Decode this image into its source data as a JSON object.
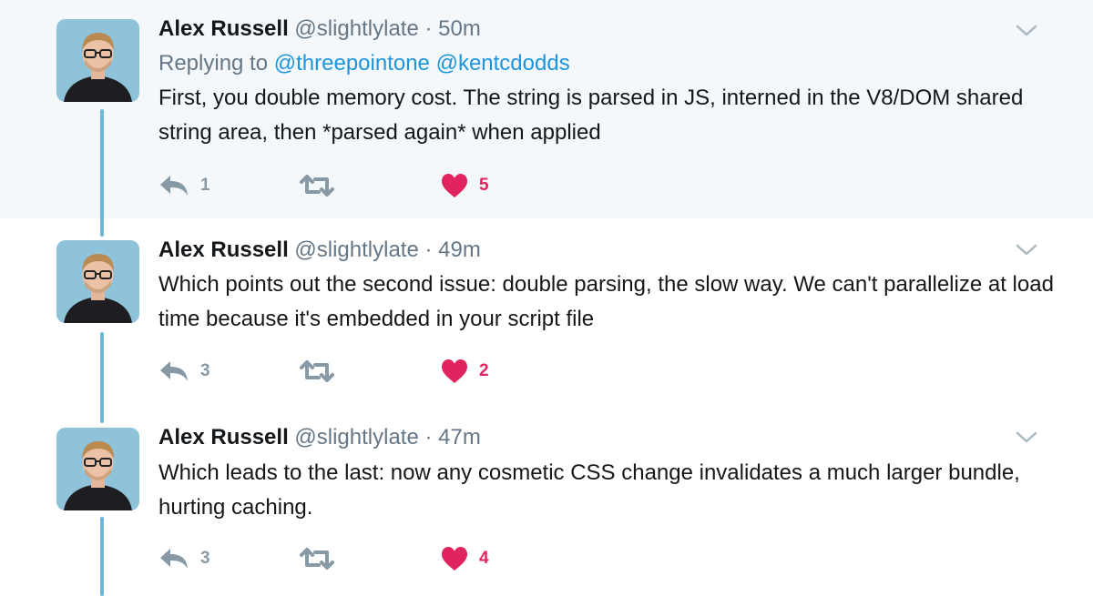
{
  "tweets": [
    {
      "name": "Alex Russell",
      "handle": "@slightlylate",
      "separator": "·",
      "time": "50m",
      "replying_prefix": "Replying to ",
      "mentions": [
        "@threepointone",
        "@kentcdodds"
      ],
      "text": "First, you double memory cost. The string is parsed in JS, interned in the V8/DOM shared string area, then *parsed again* when applied",
      "reply_count": "1",
      "retweet_count": "",
      "like_count": "5",
      "liked": true,
      "highlighted": true
    },
    {
      "name": "Alex Russell",
      "handle": "@slightlylate",
      "separator": "·",
      "time": "49m",
      "text": "Which points out the second issue: double parsing, the slow way. We can't parallelize at load time because it's embedded in your script file",
      "reply_count": "3",
      "retweet_count": "",
      "like_count": "2",
      "liked": true,
      "highlighted": false
    },
    {
      "name": "Alex Russell",
      "handle": "@slightlylate",
      "separator": "·",
      "time": "47m",
      "text": "Which leads to the last: now any cosmetic CSS change invalidates a much larger bundle, hurting caching.",
      "reply_count": "3",
      "retweet_count": "",
      "like_count": "4",
      "liked": true,
      "highlighted": false
    }
  ],
  "icons": {
    "reply": "reply-icon",
    "retweet": "retweet-icon",
    "like": "heart-icon",
    "caret": "chevron-down-icon"
  },
  "colors": {
    "thread_line": "#6fb6d6",
    "like": "#e0245e",
    "mention": "#1b95e0",
    "secondary_text": "#657786",
    "highlight_bg": "#f5f8fa"
  }
}
